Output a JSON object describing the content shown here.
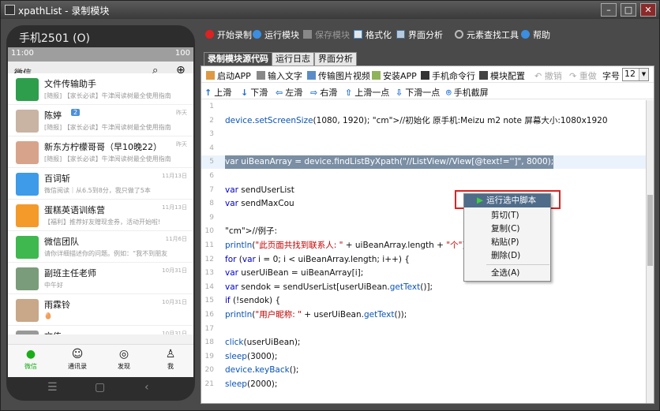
{
  "window": {
    "title": "xpathList - 录制模块"
  },
  "phone": {
    "label": "手机2501 (O)",
    "status_time": "11:00",
    "status_battery": "100",
    "wechat_title": "微信",
    "chats": [
      {
        "name": "文件传输助手",
        "preview": "[随报] 【家长必读】牛津阅读树最全使用指南...",
        "time": "",
        "color": "#2e9e4d"
      },
      {
        "name": "陈婷",
        "badge": "2",
        "preview": "[随报] 【家长必读】牛津阅读树最全使用指南...",
        "time": "昨天",
        "color": "#c9b3a3"
      },
      {
        "name": "新东方柠檬哥哥（早10晚22）",
        "preview": "[随报] 【家长必读】牛津阅读树最全使用指南...",
        "time": "昨天",
        "color": "#d8a38b"
      },
      {
        "name": "百词斩",
        "preview": "微信阅读｜从6.5到8分，我只做了5本",
        "time": "11月13日",
        "color": "#3d9be9"
      },
      {
        "name": "蛋糕英语训练营",
        "preview": "【福利】推荐好友赠现金券，活动开始啦!",
        "time": "11月13日",
        "color": "#f39a2a"
      },
      {
        "name": "微信团队",
        "preview": "请你详细描述你的问题。例如：“我不到朋友",
        "time": "11月6日",
        "color": "#3fb84f"
      },
      {
        "name": "副班主任老师",
        "preview": "中午好",
        "time": "10月31日",
        "color": "#7a9c7a"
      },
      {
        "name": "雨霖铃",
        "preview": "🥚",
        "time": "10月31日",
        "color": "#c8a888"
      },
      {
        "name": "文传",
        "preview": "",
        "time": "10月31日",
        "color": "#999999"
      }
    ],
    "tabs": [
      {
        "label": "微信",
        "icon": "chat-icon"
      },
      {
        "label": "通讯录",
        "icon": "contacts-icon"
      },
      {
        "label": "发现",
        "icon": "compass-icon"
      },
      {
        "label": "我",
        "icon": "person-icon"
      }
    ]
  },
  "toolbar": {
    "items": [
      "开始录制",
      "运行模块",
      "保存模块",
      "格式化",
      "界面分析",
      "元素查找工具",
      "帮助"
    ]
  },
  "tabs": [
    "录制模块源代码",
    "运行日志",
    "界面分析"
  ],
  "editor_toolbar": {
    "row1": [
      "启动APP",
      "输入文字",
      "传输图片视频",
      "安装APP",
      "手机命令行",
      "模块配置",
      "撤销",
      "重做",
      "字号"
    ],
    "font_size": "12",
    "row2": [
      "上滑",
      "下滑",
      "左滑",
      "右滑",
      "上滑一点",
      "下滑一点",
      "手机截屏"
    ]
  },
  "code": {
    "lines": [
      {
        "n": "1",
        "t": ""
      },
      {
        "n": "2",
        "t": "device.setScreenSize(1080, 1920); //初始化 原手机:Meizu m2 note 屏幕大小:1080x1920"
      },
      {
        "n": "3",
        "t": ""
      },
      {
        "n": "4",
        "t": ""
      },
      {
        "n": "5",
        "t": "var uiBeanArray = device.findListByXpath(\"//ListView//View[@text!='']\", 8000);"
      },
      {
        "n": "6",
        "t": ""
      },
      {
        "n": "7",
        "t": "var sendUserList"
      },
      {
        "n": "8",
        "t": "var sendMaxCou"
      },
      {
        "n": "9",
        "t": ""
      },
      {
        "n": "10",
        "t": "//例子:"
      },
      {
        "n": "11",
        "t": "println(\"此页面共找到联系人: \" + uiBeanArray.length + \"个\")"
      },
      {
        "n": "12",
        "t": "for (var i = 0; i < uiBeanArray.length; i++) {"
      },
      {
        "n": "13",
        "t": "    var userUiBean = uiBeanArray[i];"
      },
      {
        "n": "14",
        "t": "    var sendok = sendUserList[userUiBean.getText()];"
      },
      {
        "n": "15",
        "t": "    if (!sendok) {"
      },
      {
        "n": "16",
        "t": "        println(\"用户昵称: \" + userUiBean.getText());"
      },
      {
        "n": "17",
        "t": ""
      },
      {
        "n": "18",
        "t": "        click(userUiBean);"
      },
      {
        "n": "19",
        "t": "        sleep(3000);"
      },
      {
        "n": "20",
        "t": "        device.keyBack();"
      },
      {
        "n": "21",
        "t": "        sleep(2000);"
      }
    ]
  },
  "context_menu": [
    "运行选中脚本",
    "剪切(T)",
    "复制(C)",
    "粘贴(P)",
    "删除(D)",
    "全选(A)"
  ]
}
